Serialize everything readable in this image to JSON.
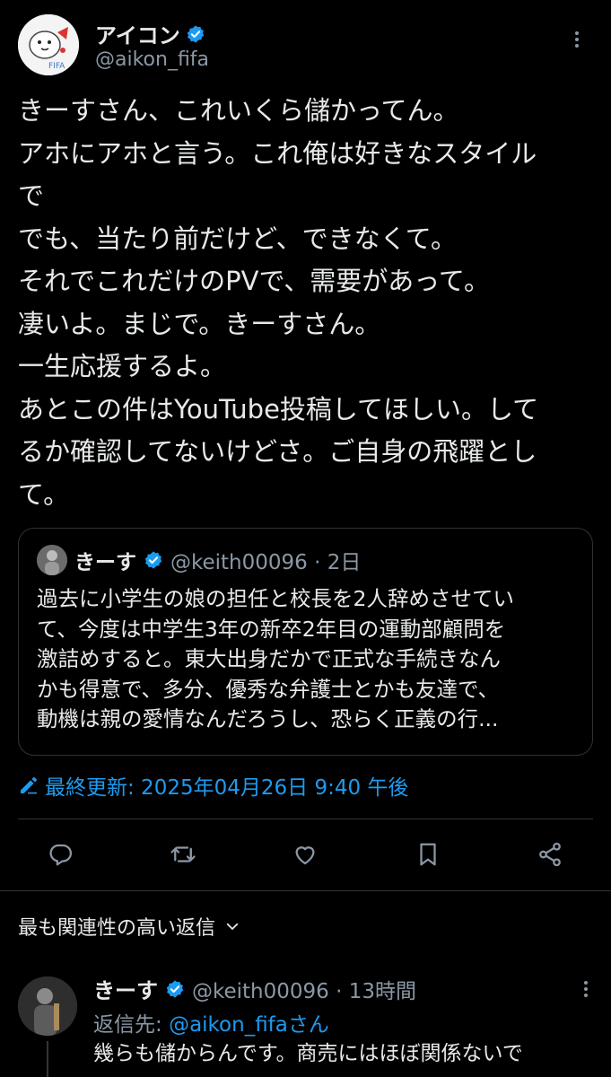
{
  "author": {
    "display_name": "アイコン",
    "handle": "@aikon_fifa",
    "avatar_badge_text": "FIFA"
  },
  "tweet": {
    "text": "きーすさん、これいくら儲かってん。\nアホにアホと言う。これ俺は好きなスタイル\nで\nでも、当たり前だけど、できなくて。\nそれでこれだけのPVで、需要があって。\n凄いよ。まじで。きーすさん。\n一生応援するよ。\nあとこの件はYouTube投稿してほしい。して\nるか確認してないけどさ。ご自身の飛躍とし\nて。"
  },
  "quote": {
    "display_name": "きーす",
    "handle_time": "@keith00096 · 2日",
    "text": "過去に小学生の娘の担任と校長を2人辞めさせてい\nて、今度は中学生3年の新卒2年目の運動部顧問を\n激詰めすると。東大出身だかで正式な手続きなん\nかも得意で、多分、優秀な弁護士とかも友達で、\n動機は親の愛情なんだろうし、恐らく正義の行..."
  },
  "edited": {
    "label": "最終更新: 2025年04月26日 9:40 午後"
  },
  "actions": [
    "reply-icon",
    "repost-icon",
    "like-icon",
    "bookmark-icon",
    "share-icon"
  ],
  "replies_header": {
    "label": "最も関連性の高い返信"
  },
  "reply": {
    "display_name": "きーす",
    "handle_time": "@keith00096 · 13時間",
    "reply_to_prefix": "返信先: ",
    "reply_to_mention": "@aikon_fifaさん",
    "text": "幾らも儲からんです。商売にはほぼ関係ないで"
  },
  "colors": {
    "background": "#000000",
    "text": "#e7e9ea",
    "secondary": "#8b98a5",
    "accent": "#1d9bf0",
    "border": "#2f3336"
  }
}
